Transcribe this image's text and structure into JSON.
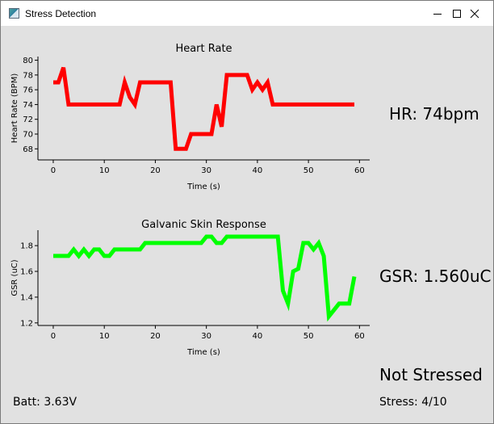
{
  "window": {
    "title": "Stress Detection",
    "minimize_icon": "minimize-icon",
    "maximize_icon": "maximize-icon",
    "close_icon": "close-icon"
  },
  "readouts": {
    "hr": "HR: 74bpm",
    "gsr": "GSR: 1.560uC",
    "status": "Not Stressed",
    "battery": "Batt: 3.63V",
    "stress": "Stress: 4/10"
  },
  "chart_data": [
    {
      "type": "line",
      "title": "Heart Rate",
      "xlabel": "Time (s)",
      "ylabel": "Heart Rate (BPM)",
      "xlim": [
        -3,
        62
      ],
      "ylim": [
        66.5,
        80.5
      ],
      "xticks": [
        0,
        10,
        20,
        30,
        40,
        50,
        60
      ],
      "yticks": [
        68,
        70,
        72,
        74,
        76,
        78,
        80
      ],
      "grid": false,
      "series": [
        {
          "color": "#ff0000",
          "x": [
            0,
            1,
            2,
            3,
            4,
            5,
            6,
            7,
            8,
            9,
            10,
            11,
            12,
            13,
            14,
            15,
            16,
            17,
            18,
            19,
            20,
            21,
            22,
            23,
            24,
            25,
            26,
            27,
            28,
            29,
            30,
            31,
            32,
            33,
            34,
            35,
            36,
            37,
            38,
            39,
            40,
            41,
            42,
            43,
            44,
            45,
            46,
            47,
            48,
            49,
            50,
            51,
            52,
            53,
            54,
            55,
            56,
            57,
            58,
            59
          ],
          "values": [
            77,
            77,
            79,
            74,
            74,
            74,
            74,
            74,
            74,
            74,
            74,
            74,
            74,
            74,
            77,
            75,
            74,
            77,
            77,
            77,
            77,
            77,
            77,
            77,
            68,
            68,
            68,
            70,
            70,
            70,
            70,
            70,
            74,
            71,
            78,
            78,
            78,
            78,
            78,
            76,
            77,
            76,
            77,
            74,
            74,
            74,
            74,
            74,
            74,
            74,
            74,
            74,
            74,
            74,
            74,
            74,
            74,
            74,
            74,
            74
          ]
        }
      ]
    },
    {
      "type": "line",
      "title": "Galvanic Skin Response",
      "xlabel": "Time (s)",
      "ylabel": "GSR (uC)",
      "xlim": [
        -3,
        62
      ],
      "ylim": [
        1.18,
        1.92
      ],
      "xticks": [
        0,
        10,
        20,
        30,
        40,
        50,
        60
      ],
      "yticks": [
        1.2,
        1.4,
        1.6,
        1.8
      ],
      "grid": false,
      "series": [
        {
          "color": "#00ff00",
          "x": [
            0,
            1,
            2,
            3,
            4,
            5,
            6,
            7,
            8,
            9,
            10,
            11,
            12,
            13,
            14,
            15,
            16,
            17,
            18,
            19,
            20,
            21,
            22,
            23,
            24,
            25,
            26,
            27,
            28,
            29,
            30,
            31,
            32,
            33,
            34,
            35,
            36,
            37,
            38,
            39,
            40,
            41,
            42,
            43,
            44,
            45,
            46,
            47,
            48,
            49,
            50,
            51,
            52,
            53,
            54,
            55,
            56,
            57,
            58,
            59
          ],
          "values": [
            1.72,
            1.72,
            1.72,
            1.72,
            1.77,
            1.72,
            1.77,
            1.72,
            1.77,
            1.77,
            1.72,
            1.72,
            1.77,
            1.77,
            1.77,
            1.77,
            1.77,
            1.77,
            1.82,
            1.82,
            1.82,
            1.82,
            1.82,
            1.82,
            1.82,
            1.82,
            1.82,
            1.82,
            1.82,
            1.82,
            1.87,
            1.87,
            1.82,
            1.82,
            1.87,
            1.87,
            1.87,
            1.87,
            1.87,
            1.87,
            1.87,
            1.87,
            1.87,
            1.87,
            1.87,
            1.45,
            1.35,
            1.6,
            1.62,
            1.82,
            1.82,
            1.77,
            1.82,
            1.72,
            1.25,
            1.3,
            1.35,
            1.35,
            1.35,
            1.56
          ]
        }
      ]
    }
  ]
}
